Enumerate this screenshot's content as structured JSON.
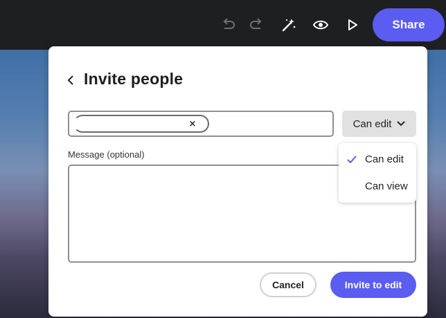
{
  "toolbar": {
    "icons": [
      "undo-icon",
      "redo-icon",
      "magic-wand-icon",
      "preview-eye-icon",
      "play-icon"
    ],
    "share_label": "Share",
    "accent_color": "#5b5cf0"
  },
  "dialog": {
    "title": "Invite people",
    "invite_chip_remove": "×",
    "permission_dropdown": {
      "selected": "Can edit",
      "options": [
        {
          "label": "Can edit",
          "checked": true
        },
        {
          "label": "Can view",
          "checked": false
        }
      ]
    },
    "message_label": "Message (optional)",
    "message_value": "",
    "cancel_label": "Cancel",
    "invite_label": "Invite to edit"
  }
}
